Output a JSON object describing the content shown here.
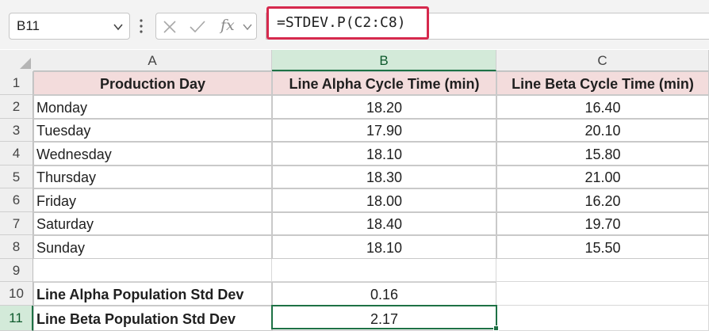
{
  "name_box": {
    "value": "B11"
  },
  "formula_bar": {
    "formula": "=STDEV.P(C2:C8)",
    "fx_label": "fx"
  },
  "icons": {
    "namebox_dropdown": "chevron-down-icon",
    "cancel": "x-icon",
    "enter": "check-icon",
    "more": "vertical-dots-icon"
  },
  "colors": {
    "header_fill": "#f3dcdc",
    "selection": "#1e7145",
    "highlight": "#d6294d"
  },
  "columns": [
    "A",
    "B",
    "C"
  ],
  "rows": [
    "1",
    "2",
    "3",
    "4",
    "5",
    "6",
    "7",
    "8",
    "9",
    "10",
    "11"
  ],
  "table": {
    "headers": [
      "Production Day",
      "Line Alpha Cycle Time (min)",
      "Line Beta Cycle Time (min)"
    ],
    "data": [
      [
        "Monday",
        "18.20",
        "16.40"
      ],
      [
        "Tuesday",
        "17.90",
        "20.10"
      ],
      [
        "Wednesday",
        "18.10",
        "15.80"
      ],
      [
        "Thursday",
        "18.30",
        "21.00"
      ],
      [
        "Friday",
        "18.00",
        "16.20"
      ],
      [
        "Saturday",
        "18.40",
        "19.70"
      ],
      [
        "Sunday",
        "18.10",
        "15.50"
      ]
    ]
  },
  "summary": [
    {
      "label": "Line Alpha Population Std Dev",
      "value": "0.16"
    },
    {
      "label": "Line Beta Population Std Dev",
      "value": "2.17"
    }
  ]
}
